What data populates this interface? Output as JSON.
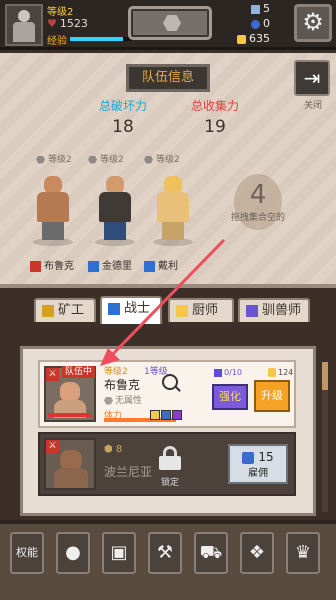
{
  "topbar": {
    "level": "等级2",
    "hp": "1523",
    "xp_label": "经验",
    "xp_progress": 0.85,
    "resource_wrench": "5",
    "resource_gem": "0",
    "resource_coin": "635"
  },
  "team": {
    "title": "队伍信息",
    "close_label": "关闭",
    "power_label": "总破坏力",
    "power_value": "18",
    "gather_label": "总收集力",
    "gather_value": "19",
    "empty_count": "4",
    "empty_text": "拖拽集合空的",
    "members": [
      {
        "level": "等级2",
        "name": "布鲁克"
      },
      {
        "level": "等级2",
        "name": "金德里"
      },
      {
        "level": "等级2",
        "name": "戴利"
      }
    ]
  },
  "tabs": [
    {
      "label": "矿工"
    },
    {
      "label": "战士"
    },
    {
      "label": "厨师"
    },
    {
      "label": "驯兽师"
    }
  ],
  "list": {
    "card1": {
      "badge": "队伍中",
      "level": "等级2",
      "rank": "1等级",
      "name": "布鲁克",
      "attribute": "无属性",
      "stamina_label": "体力",
      "stamina": 1.0,
      "mana": "0/10",
      "coin": "124",
      "strengthen": "强化",
      "upgrade": "升级"
    },
    "card2": {
      "level": "8",
      "name": "波兰尼亚",
      "lock_label": "锁定",
      "hire_cost": "15",
      "hire_label": "雇佣"
    }
  },
  "nav": {
    "items": [
      {
        "label": "权能"
      }
    ]
  },
  "colors": {
    "power": "#19a8d8",
    "gather": "#e34040",
    "upgrade": "#f4a224",
    "strengthen": "#7d5ad9"
  }
}
